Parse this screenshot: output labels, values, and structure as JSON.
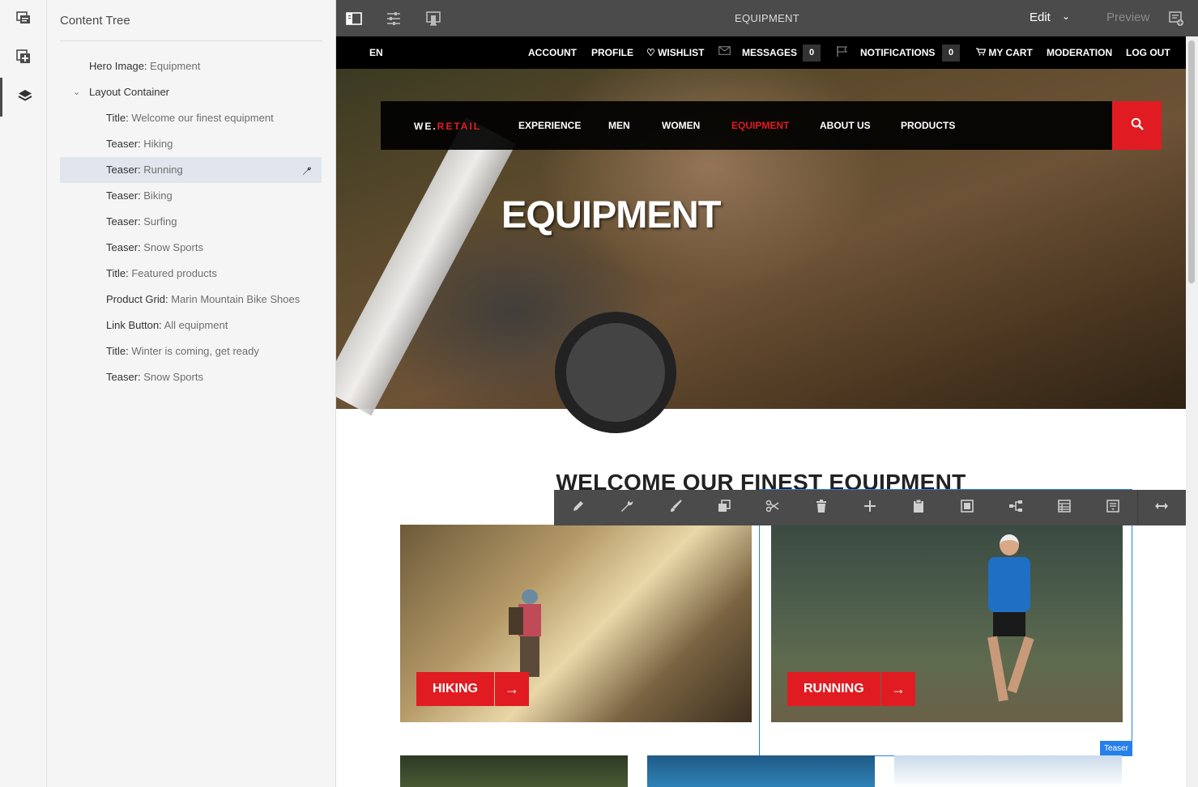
{
  "rail": {
    "items": [
      {
        "icon": "page-info-icon"
      },
      {
        "icon": "components-add-icon"
      },
      {
        "icon": "layers-icon"
      }
    ]
  },
  "panel": {
    "title": "Content Tree",
    "items": [
      {
        "type": "Hero Image:",
        "value": "Equipment"
      },
      {
        "type": "Layout Container",
        "value": ""
      },
      {
        "type": "Title:",
        "value": "Welcome our finest equipment"
      },
      {
        "type": "Teaser:",
        "value": "Hiking"
      },
      {
        "type": "Teaser:",
        "value": "Running"
      },
      {
        "type": "Teaser:",
        "value": "Biking"
      },
      {
        "type": "Teaser:",
        "value": "Surfing"
      },
      {
        "type": "Teaser:",
        "value": "Snow Sports"
      },
      {
        "type": "Title:",
        "value": "Featured products"
      },
      {
        "type": "Product Grid:",
        "value": "Marin Mountain Bike Shoes"
      },
      {
        "type": "Link Button:",
        "value": "All equipment"
      },
      {
        "type": "Title:",
        "value": "Winter is coming, get ready"
      },
      {
        "type": "Teaser:",
        "value": "Snow Sports"
      }
    ],
    "selected_index": 4
  },
  "topbar": {
    "title": "EQUIPMENT",
    "mode": "Edit",
    "preview": "Preview"
  },
  "site": {
    "util": {
      "lang": "EN",
      "account": "ACCOUNT",
      "profile": "PROFILE",
      "wishlist": "WISHLIST",
      "messages": "MESSAGES",
      "messages_count": "0",
      "notifications": "NOTIFICATIONS",
      "notifications_count": "0",
      "cart": "MY CART",
      "moderation": "MODERATION",
      "logout": "LOG OUT"
    },
    "brand": {
      "we": "WE.",
      "retail": "RETAIL"
    },
    "nav": [
      "EXPERIENCE",
      "MEN",
      "WOMEN",
      "EQUIPMENT",
      "ABOUT US",
      "PRODUCTS"
    ],
    "nav_active": "EQUIPMENT",
    "hero_title": "EQUIPMENT",
    "section_title": "WELCOME OUR FINEST EQUIPMENT",
    "cards": [
      {
        "label": "HIKING",
        "arrow": "→"
      },
      {
        "label": "RUNNING",
        "arrow": "→"
      }
    ],
    "selection_label": "Teaser"
  },
  "component_toolbar": {
    "actions": [
      "edit-icon",
      "configure-icon",
      "style-icon",
      "copy-icon",
      "cut-icon",
      "delete-icon",
      "insert-icon",
      "paste-icon",
      "group-icon",
      "parent-icon",
      "layout-icon",
      "convert-icon",
      "layout-mode-icon"
    ]
  },
  "colors": {
    "accent": "#e01c22",
    "selection": "#2680eb",
    "editor_bar": "#4b4b4b",
    "panel_bg": "#f5f5f5"
  }
}
